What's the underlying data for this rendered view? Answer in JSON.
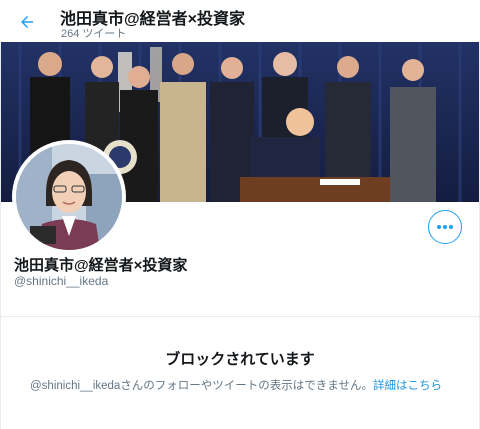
{
  "header": {
    "title": "池田真市@経営者×投資家",
    "tweet_count": "264 ツイート"
  },
  "profile": {
    "display_name": "池田真市@経営者×投資家",
    "handle": "@shinichi__ikeda"
  },
  "blocked": {
    "title": "ブロックされています",
    "message": "@shinichi__ikedaさんのフォローやツイートの表示はできません。",
    "link": "詳細はこちら"
  },
  "colors": {
    "accent": "#1da1f2",
    "text": "#14171a",
    "secondary_text": "#657786"
  },
  "icons": {
    "back": "arrow-left-icon",
    "more": "more-horizontal-icon"
  }
}
